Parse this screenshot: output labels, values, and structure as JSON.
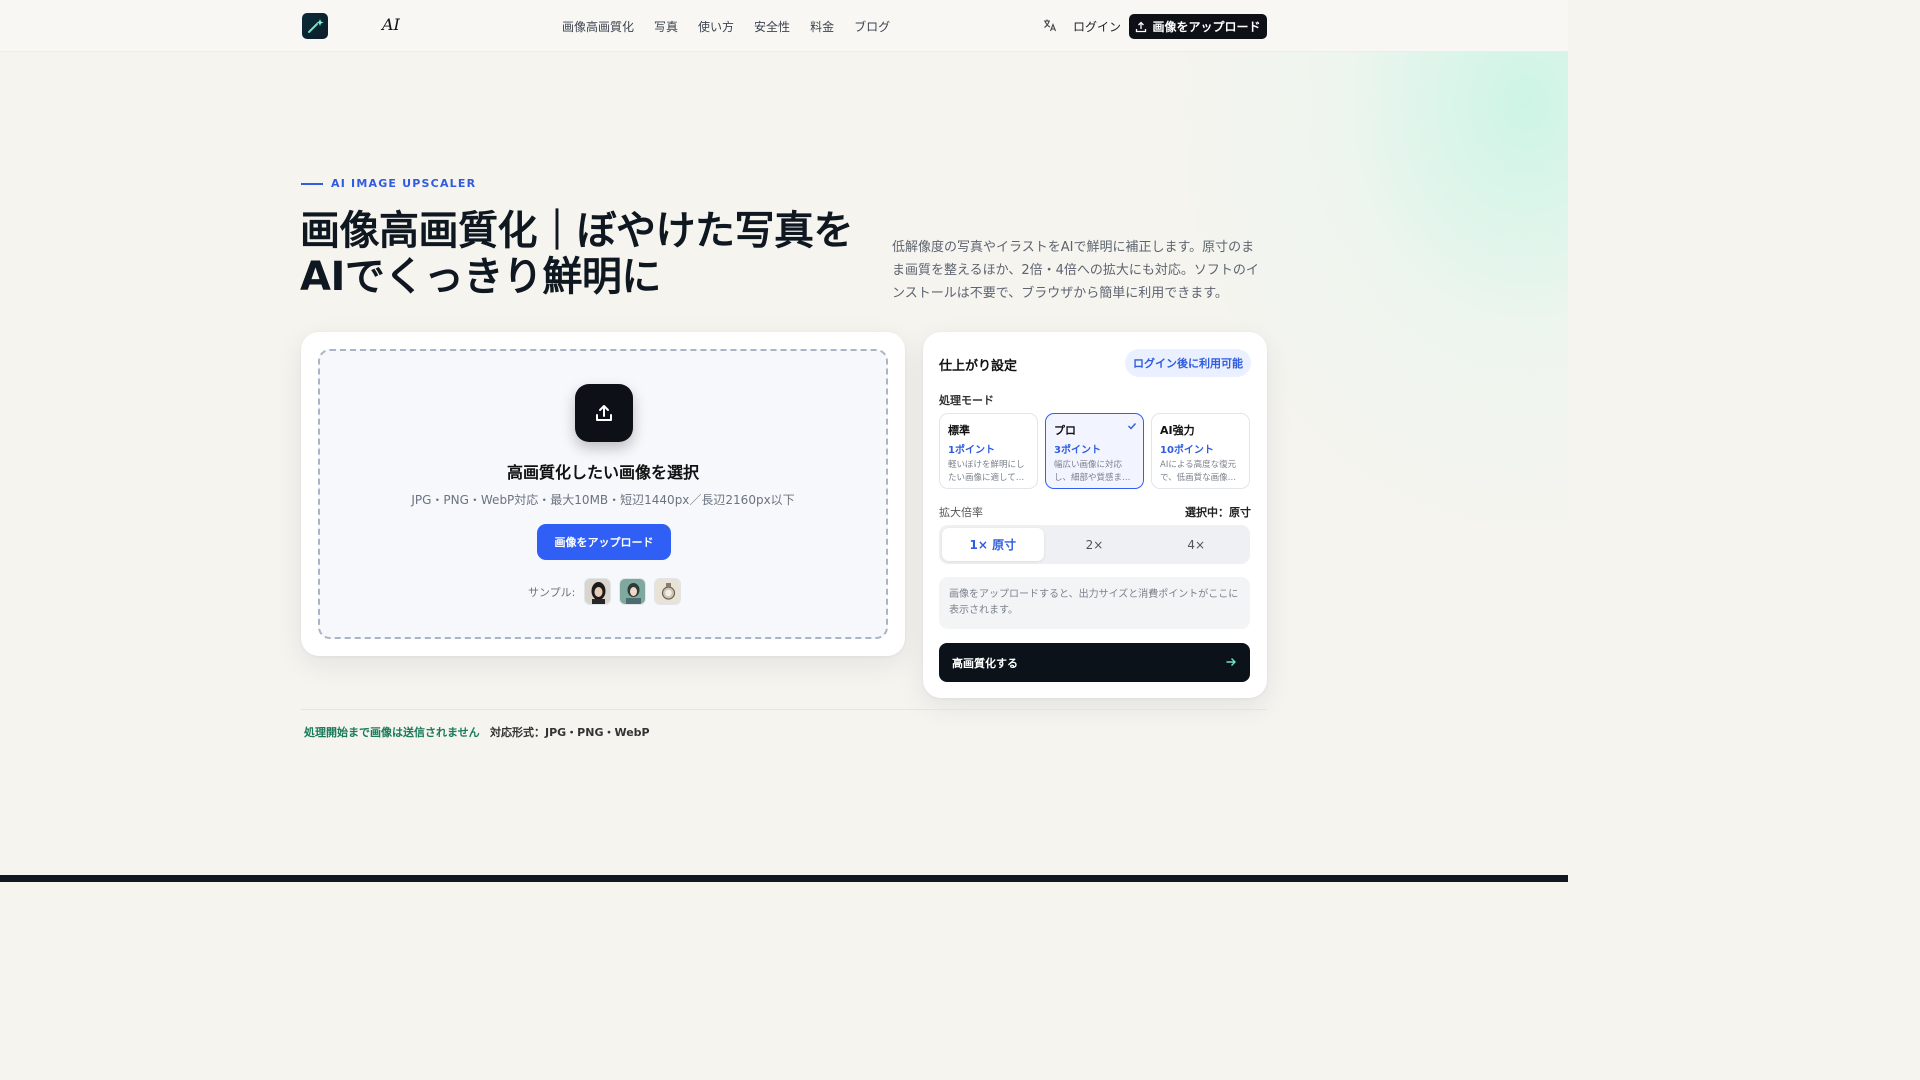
{
  "header": {
    "brand": "AI",
    "nav": [
      "画像高画質化",
      "写真",
      "使い方",
      "安全性",
      "料金",
      "ブログ"
    ],
    "login": "ログイン",
    "upload_button": "画像をアップロード"
  },
  "hero": {
    "eyebrow": "AI IMAGE UPSCALER",
    "title": "画像高画質化｜ぼやけた写真をAIでくっきり鮮明に",
    "description": "低解像度の写真やイラストをAIで鮮明に補正します。原寸のまま画質を整えるほか、2倍・4倍への拡大にも対応。ソフトのインストールは不要で、ブラウザから簡単に利用できます。"
  },
  "upload": {
    "title": "高画質化したい画像を選択",
    "subtitle": "JPG・PNG・WebP対応・最大10MB・短辺1440px／長辺2160px以下",
    "button": "画像をアップロード",
    "samples_label": "サンプル:"
  },
  "settings": {
    "title": "仕上がり設定",
    "badge": "ログイン後に利用可能",
    "mode_label": "処理モード",
    "modes": [
      {
        "name": "標準",
        "points": "1ポイント",
        "desc": "軽いぼけを鮮明にしたい画像に適して…"
      },
      {
        "name": "プロ",
        "points": "3ポイント",
        "desc": "幅広い画像に対応し、細部や質感ま…"
      },
      {
        "name": "AI強力",
        "points": "10ポイント",
        "desc": "AIによる高度な復元で、低画質な画像…"
      }
    ],
    "selected_mode": "プロ",
    "scale_label": "拡大倍率",
    "scale_selected": "選択中：原寸",
    "scales": [
      "1× 原寸",
      "2×",
      "4×"
    ],
    "info": "画像をアップロードすると、出力サイズと消費ポイントがここに表示されます。",
    "submit": "高画質化する"
  },
  "footer": {
    "note_privacy": "処理開始まで画像は送信されません",
    "note_formats": "対応形式：JPG・PNG・WebP"
  },
  "colors": {
    "accent": "#2f5ff5",
    "dark": "#0d1117",
    "privacy_green": "#1a7a5a"
  }
}
